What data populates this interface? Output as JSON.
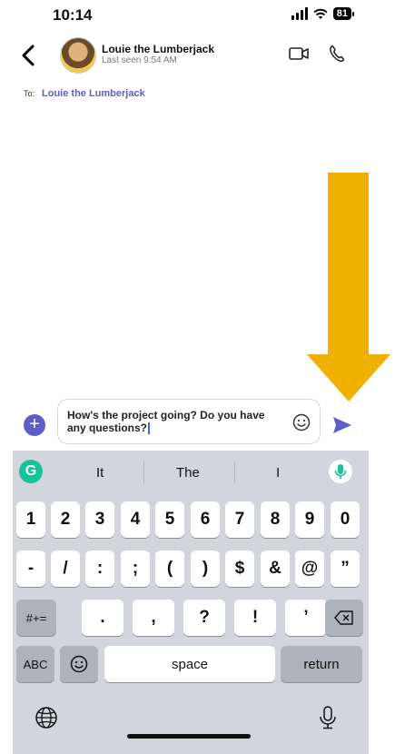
{
  "status": {
    "time": "10:14",
    "battery": "81"
  },
  "header": {
    "name": "Louie the Lumberjack",
    "last_seen": "Last seen 9:54 AM"
  },
  "to": {
    "label": "To:",
    "name": "Louie the Lumberjack"
  },
  "compose": {
    "text": "How's the project going? Do you have any questions?"
  },
  "keyboard": {
    "suggestions": [
      "It",
      "The",
      "I"
    ],
    "row1": [
      "1",
      "2",
      "3",
      "4",
      "5",
      "6",
      "7",
      "8",
      "9",
      "0"
    ],
    "row2": [
      "-",
      "/",
      ":",
      ";",
      "(",
      ")",
      "$",
      "&",
      "@",
      "”"
    ],
    "row3": {
      "mode": "#+=",
      "keys": [
        ".",
        ",",
        "?",
        "!",
        "’"
      ]
    },
    "row4": {
      "abc": "ABC",
      "space": "space",
      "return": "return"
    }
  },
  "colors": {
    "accent": "#5b5fc7",
    "arrow": "#f0b000",
    "grammarly": "#15c39a"
  }
}
